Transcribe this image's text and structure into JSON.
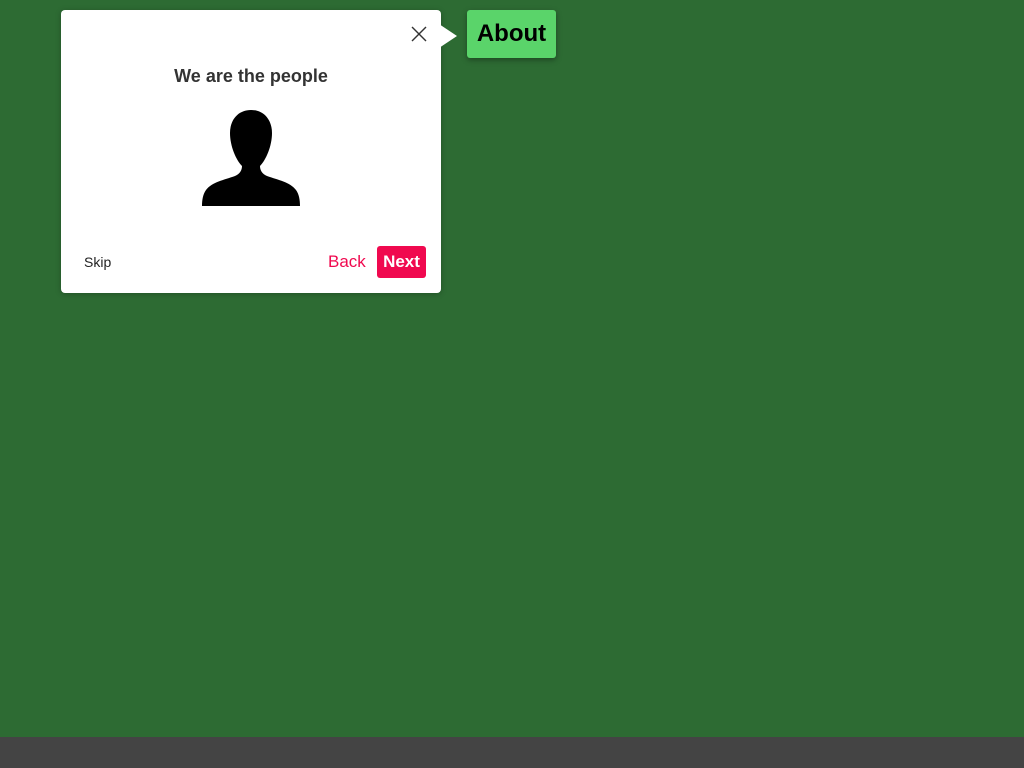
{
  "tour": {
    "title": "We are the people",
    "skip_label": "Skip",
    "back_label": "Back",
    "next_label": "Next",
    "image_icon": "person-silhouette-icon",
    "close_icon": "close-icon"
  },
  "target": {
    "label": "About"
  },
  "colors": {
    "background": "#2d6b33",
    "footer": "#444444",
    "accent": "#f0094f",
    "target_highlight": "#5ad46a",
    "popover": "#ffffff"
  }
}
